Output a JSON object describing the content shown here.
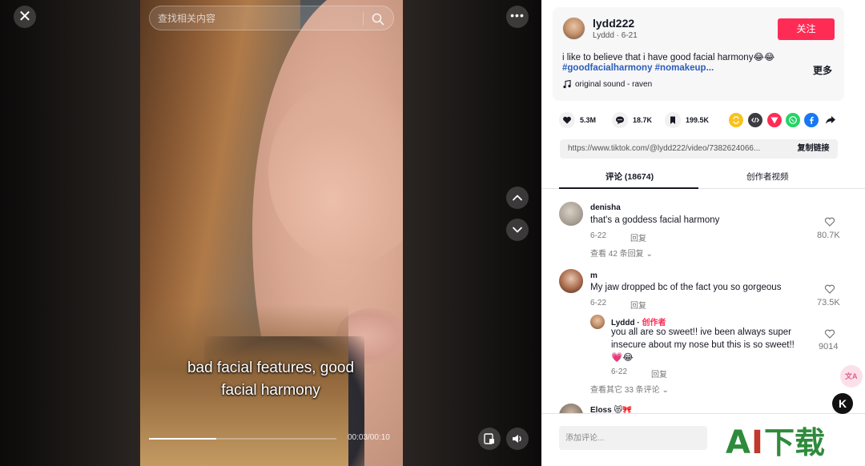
{
  "video": {
    "caption_line1": "bad facial features, good",
    "caption_line2": "facial harmony",
    "search_placeholder": "查找相关内容",
    "time": "00:03/00:10",
    "progress": 0.36
  },
  "author": {
    "username": "lydd222",
    "nickname_date": "Lyddd · 6-21",
    "follow_label": "关注",
    "description": "i like to believe that i have good facial harmony😂😂",
    "tags": "#goodfacialharmony #nomakeup...",
    "more_label": "更多",
    "music": "original sound - raven"
  },
  "stats": {
    "likes": "5.3M",
    "comments": "18.7K",
    "saves": "199.5K"
  },
  "share_colors": [
    "#f8c21e",
    "#3b3b40",
    "#fe2c55",
    "#25d366",
    "#1877f2"
  ],
  "link": {
    "url": "https://www.tiktok.com/@lydd222/video/7382624066...",
    "copy_label": "复制链接"
  },
  "tabs": {
    "comments": "评论 (18674)",
    "creator_videos": "创作者视频"
  },
  "comments": [
    {
      "user": "denisha",
      "text": "that's a goddess facial harmony",
      "date": "6-22",
      "reply": "回复",
      "likes": "80.7K",
      "view_replies": "查看 42 条回复 ⌄"
    },
    {
      "user": "m",
      "text": "My jaw dropped bc of the fact you so gorgeous",
      "date": "6-22",
      "reply": "回复",
      "likes": "73.5K",
      "sub_reply": {
        "user": "Lyddd · ",
        "creator": "创作者",
        "text_line1": "you all are so sweet!! ive been always super",
        "text_line2": "insecure about my nose but this is so sweet!!",
        "text_line3": "💗😂",
        "date": "6-22",
        "reply": "回复",
        "likes": "9014"
      },
      "view_replies": "查看其它 33 条评论 ⌄"
    },
    {
      "user": "Eloss 😻🎀"
    }
  ],
  "comment_input": {
    "placeholder": "添加评论..."
  },
  "floating": {
    "translate": "文A",
    "logo": "K"
  },
  "watermark": {
    "a": "A",
    "i": "I",
    "rest": "下载"
  }
}
